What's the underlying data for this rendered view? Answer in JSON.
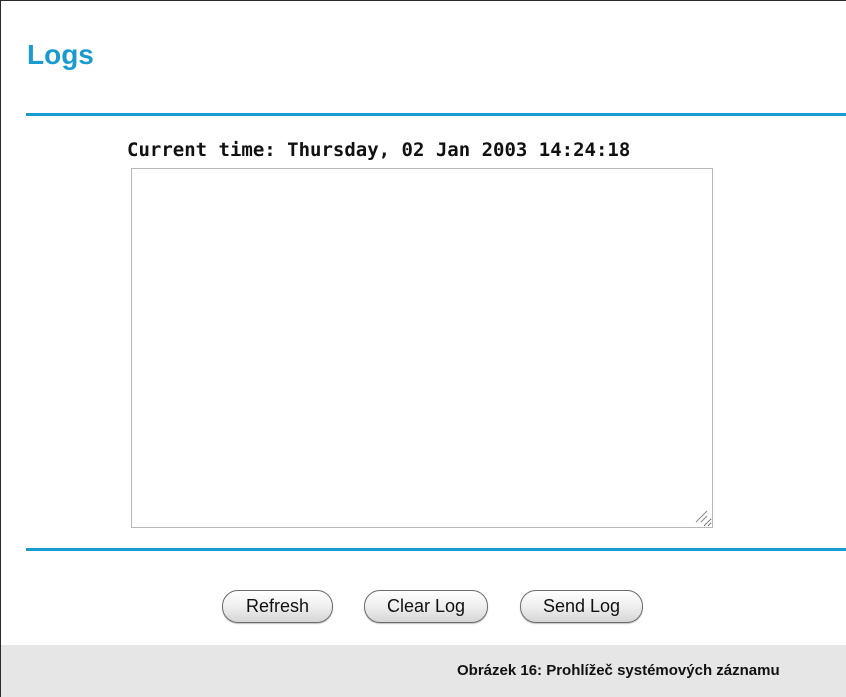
{
  "page": {
    "title": "Logs",
    "accent_color": "#1a9bd0"
  },
  "log_viewer": {
    "current_time": "Current time: Thursday, 02 Jan 2003 14:24:18",
    "log_content": ""
  },
  "buttons": {
    "refresh_label": "Refresh",
    "clear_label": "Clear Log",
    "send_label": "Send Log"
  },
  "caption": {
    "text": "Obrázek 16: Prohlížeč systémových záznamu"
  }
}
